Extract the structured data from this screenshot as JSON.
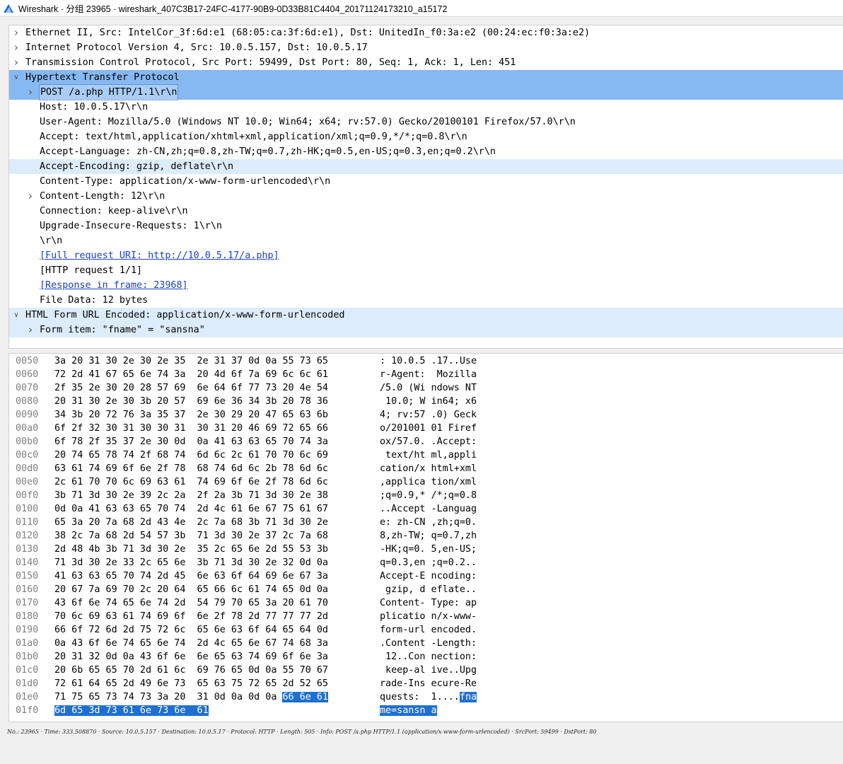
{
  "window": {
    "title": "Wireshark · 分组 23965 · wireshark_407C3B17-24FC-4177-90B9-0D33B81C4404_20171124173210_a15172"
  },
  "tree": [
    {
      "text": "Ethernet II, Src: IntelCor_3f:6d:e1 (68:05:ca:3f:6d:e1), Dst: UnitedIn_f0:3a:e2 (00:24:ec:f0:3a:e2)",
      "arrow": "collapsed",
      "level": 0
    },
    {
      "text": "Internet Protocol Version 4, Src: 10.0.5.157, Dst: 10.0.5.17",
      "arrow": "collapsed",
      "level": 0
    },
    {
      "text": "Transmission Control Protocol, Src Port: 59499, Dst Port: 80, Seq: 1, Ack: 1, Len: 451",
      "arrow": "collapsed",
      "level": 0
    },
    {
      "text": "Hypertext Transfer Protocol",
      "arrow": "expanded",
      "level": 0,
      "highlight": "strong"
    },
    {
      "text": "POST /a.php HTTP/1.1\\r\\n",
      "arrow": "collapsed",
      "level": 1,
      "highlight": "strong",
      "boxed": true
    },
    {
      "text": "Host: 10.0.5.17\\r\\n",
      "arrow": "none",
      "level": 1
    },
    {
      "text": "User-Agent: Mozilla/5.0 (Windows NT 10.0; Win64; x64; rv:57.0) Gecko/20100101 Firefox/57.0\\r\\n",
      "arrow": "none",
      "level": 1
    },
    {
      "text": "Accept: text/html,application/xhtml+xml,application/xml;q=0.9,*/*;q=0.8\\r\\n",
      "arrow": "none",
      "level": 1
    },
    {
      "text": "Accept-Language: zh-CN,zh;q=0.8,zh-TW;q=0.7,zh-HK;q=0.5,en-US;q=0.3,en;q=0.2\\r\\n",
      "arrow": "none",
      "level": 1
    },
    {
      "text": "Accept-Encoding: gzip, deflate\\r\\n",
      "arrow": "none",
      "level": 1,
      "highlight": "light"
    },
    {
      "text": "Content-Type: application/x-www-form-urlencoded\\r\\n",
      "arrow": "none",
      "level": 1
    },
    {
      "text": "Content-Length: 12\\r\\n",
      "arrow": "collapsed",
      "level": 1
    },
    {
      "text": "Connection: keep-alive\\r\\n",
      "arrow": "none",
      "level": 1
    },
    {
      "text": "Upgrade-Insecure-Requests: 1\\r\\n",
      "arrow": "none",
      "level": 1
    },
    {
      "text": "\\r\\n",
      "arrow": "none",
      "level": 1
    },
    {
      "text": "[Full request URI: http://10.0.5.17/a.php]",
      "arrow": "none",
      "level": 1,
      "link": true
    },
    {
      "text": "[HTTP request 1/1]",
      "arrow": "none",
      "level": 1
    },
    {
      "text": "[Response in frame: 23968]",
      "arrow": "none",
      "level": 1,
      "link": true
    },
    {
      "text": "File Data: 12 bytes",
      "arrow": "none",
      "level": 1
    },
    {
      "text": "HTML Form URL Encoded: application/x-www-form-urlencoded",
      "arrow": "expanded",
      "level": 0,
      "highlight": "light"
    },
    {
      "text": "Form item: \"fname\" = \"sansna\"",
      "arrow": "collapsed",
      "level": 1,
      "highlight": "light"
    }
  ],
  "bytes": [
    {
      "off": "0050",
      "hex": "3a 20 31 30 2e 30 2e 35  2e 31 37 0d 0a 55 73 65",
      "ascii": ": 10.0.5 .17..Use"
    },
    {
      "off": "0060",
      "hex": "72 2d 41 67 65 6e 74 3a  20 4d 6f 7a 69 6c 6c 61",
      "ascii": "r-Agent:  Mozilla"
    },
    {
      "off": "0070",
      "hex": "2f 35 2e 30 20 28 57 69  6e 64 6f 77 73 20 4e 54",
      "ascii": "/5.0 (Wi ndows NT"
    },
    {
      "off": "0080",
      "hex": "20 31 30 2e 30 3b 20 57  69 6e 36 34 3b 20 78 36",
      "ascii": " 10.0; W in64; x6"
    },
    {
      "off": "0090",
      "hex": "34 3b 20 72 76 3a 35 37  2e 30 29 20 47 65 63 6b",
      "ascii": "4; rv:57 .0) Geck"
    },
    {
      "off": "00a0",
      "hex": "6f 2f 32 30 31 30 30 31  30 31 20 46 69 72 65 66",
      "ascii": "o/201001 01 Firef"
    },
    {
      "off": "00b0",
      "hex": "6f 78 2f 35 37 2e 30 0d  0a 41 63 63 65 70 74 3a",
      "ascii": "ox/57.0. .Accept:"
    },
    {
      "off": "00c0",
      "hex": "20 74 65 78 74 2f 68 74  6d 6c 2c 61 70 70 6c 69",
      "ascii": " text/ht ml,appli"
    },
    {
      "off": "00d0",
      "hex": "63 61 74 69 6f 6e 2f 78  68 74 6d 6c 2b 78 6d 6c",
      "ascii": "cation/x html+xml"
    },
    {
      "off": "00e0",
      "hex": "2c 61 70 70 6c 69 63 61  74 69 6f 6e 2f 78 6d 6c",
      "ascii": ",applica tion/xml"
    },
    {
      "off": "00f0",
      "hex": "3b 71 3d 30 2e 39 2c 2a  2f 2a 3b 71 3d 30 2e 38",
      "ascii": ";q=0.9,* /*;q=0.8"
    },
    {
      "off": "0100",
      "hex": "0d 0a 41 63 63 65 70 74  2d 4c 61 6e 67 75 61 67",
      "ascii": "..Accept -Languag"
    },
    {
      "off": "0110",
      "hex": "65 3a 20 7a 68 2d 43 4e  2c 7a 68 3b 71 3d 30 2e",
      "ascii": "e: zh-CN ,zh;q=0."
    },
    {
      "off": "0120",
      "hex": "38 2c 7a 68 2d 54 57 3b  71 3d 30 2e 37 2c 7a 68",
      "ascii": "8,zh-TW; q=0.7,zh"
    },
    {
      "off": "0130",
      "hex": "2d 48 4b 3b 71 3d 30 2e  35 2c 65 6e 2d 55 53 3b",
      "ascii": "-HK;q=0. 5,en-US;"
    },
    {
      "off": "0140",
      "hex": "71 3d 30 2e 33 2c 65 6e  3b 71 3d 30 2e 32 0d 0a",
      "ascii": "q=0.3,en ;q=0.2.."
    },
    {
      "off": "0150",
      "hex": "41 63 63 65 70 74 2d 45  6e 63 6f 64 69 6e 67 3a",
      "ascii": "Accept-E ncoding:"
    },
    {
      "off": "0160",
      "hex": "20 67 7a 69 70 2c 20 64  65 66 6c 61 74 65 0d 0a",
      "ascii": " gzip, d eflate.."
    },
    {
      "off": "0170",
      "hex": "43 6f 6e 74 65 6e 74 2d  54 79 70 65 3a 20 61 70",
      "ascii": "Content- Type: ap"
    },
    {
      "off": "0180",
      "hex": "70 6c 69 63 61 74 69 6f  6e 2f 78 2d 77 77 77 2d",
      "ascii": "plicatio n/x-www-"
    },
    {
      "off": "0190",
      "hex": "66 6f 72 6d 2d 75 72 6c  65 6e 63 6f 64 65 64 0d",
      "ascii": "form-url encoded."
    },
    {
      "off": "01a0",
      "hex": "0a 43 6f 6e 74 65 6e 74  2d 4c 65 6e 67 74 68 3a",
      "ascii": ".Content -Length:"
    },
    {
      "off": "01b0",
      "hex": "20 31 32 0d 0a 43 6f 6e  6e 65 63 74 69 6f 6e 3a",
      "ascii": " 12..Con nection:"
    },
    {
      "off": "01c0",
      "hex": "20 6b 65 65 70 2d 61 6c  69 76 65 0d 0a 55 70 67",
      "ascii": " keep-al ive..Upg"
    },
    {
      "off": "01d0",
      "hex": "72 61 64 65 2d 49 6e 73  65 63 75 72 65 2d 52 65",
      "ascii": "rade-Ins ecure-Re"
    },
    {
      "off": "01e0",
      "hex": "71 75 65 73 74 73 3a 20  31 0d 0a 0d 0a ",
      "hex_sel": "66 6e 61",
      "ascii": "quests:  1....",
      "ascii_sel": "fna"
    },
    {
      "off": "01f0",
      "hex": "",
      "hex_sel": "6d 65 3d 73 61 6e 73 6e  61",
      "ascii": "",
      "ascii_sel": "me=sansn a"
    }
  ],
  "status": {
    "text": "No.: 23965 · Time: 333.508870 · Source: 10.0.5.157 · Destination: 10.0.5.17 · Protocol: HTTP · Length: 505 · Info: POST /a.php HTTP/1.1 (application/x-www-form-urlencoded) · SrcPort: 59499 · DstPort: 80"
  },
  "colors": {
    "highlight_strong": "#86b8f2",
    "highlight_light": "#dcecfb",
    "selection": "#1f6fd0",
    "link": "#1a40c8"
  }
}
